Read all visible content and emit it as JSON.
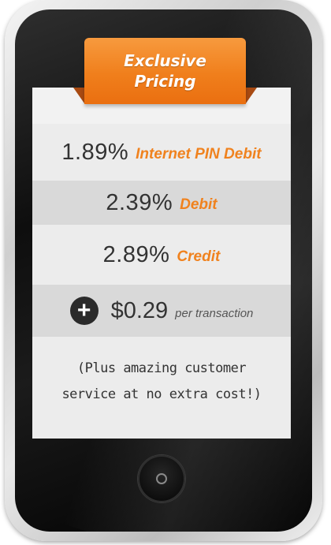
{
  "ribbon": {
    "line1": "Exclusive",
    "line2": "Pricing",
    "color": "#f07f1c"
  },
  "rates": [
    {
      "percent": "1.89%",
      "label": "Internet PIN Debit"
    },
    {
      "percent": "2.39%",
      "label": "Debit"
    },
    {
      "percent": "2.89%",
      "label": "Credit"
    }
  ],
  "fee": {
    "icon": "plus-icon",
    "amount": "$0.29",
    "unit": "per transaction"
  },
  "note": {
    "line1": "(Plus amazing customer",
    "line2": "service at no extra cost!)"
  },
  "colors": {
    "accent": "#f0821e",
    "screen": "#ececec",
    "phone": "#111111"
  }
}
